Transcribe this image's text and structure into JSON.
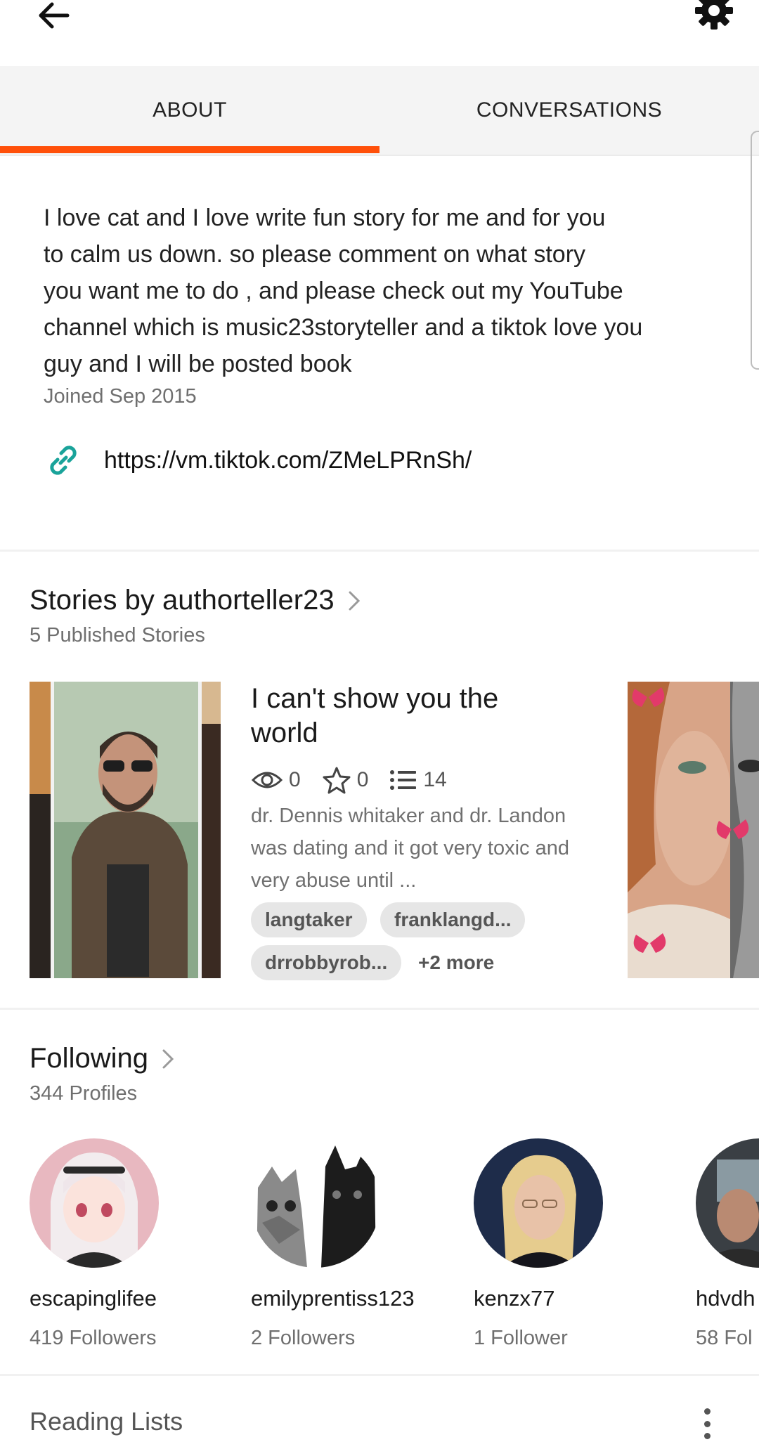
{
  "tabs": [
    {
      "label": "ABOUT",
      "active": true
    },
    {
      "label": "CONVERSATIONS",
      "active": false
    }
  ],
  "accent_color": "#ff500a",
  "link_icon_color": "#1aa39a",
  "about": {
    "bio_lines": [
      "I love cat and I love write fun story for me and for you",
      "to calm us down. so please comment on what story",
      "you want me to do , and please check out my YouTube",
      "channel which is music23storyteller and a tiktok love you",
      "guy and I will be posted book"
    ],
    "joined": "Joined Sep 2015",
    "link_url": "https://vm.tiktok.com/ZMeLPRnSh/"
  },
  "stories": {
    "title": "Stories by authorteller23",
    "subtitle": "5 Published Stories",
    "featured": {
      "title": "I can't show you the world",
      "reads": "0",
      "votes": "0",
      "parts": "14",
      "description": "dr. Dennis whitaker and dr. Landon was dating and it got very toxic and very abuse until ...",
      "tags": [
        "langtaker",
        "franklangd...",
        "drrobbyrob..."
      ],
      "more_tags": "+2 more"
    }
  },
  "following": {
    "title": "Following",
    "subtitle": "344 Profiles",
    "profiles": [
      {
        "name": "escapinglifee",
        "followers": "419 Followers"
      },
      {
        "name": "emilyprentiss123",
        "followers": "2 Followers"
      },
      {
        "name": "kenzx77",
        "followers": "1 Follower"
      },
      {
        "name": "hdvdh",
        "followers": "58 Fol"
      }
    ]
  },
  "reading_lists": {
    "title": "Reading Lists"
  }
}
